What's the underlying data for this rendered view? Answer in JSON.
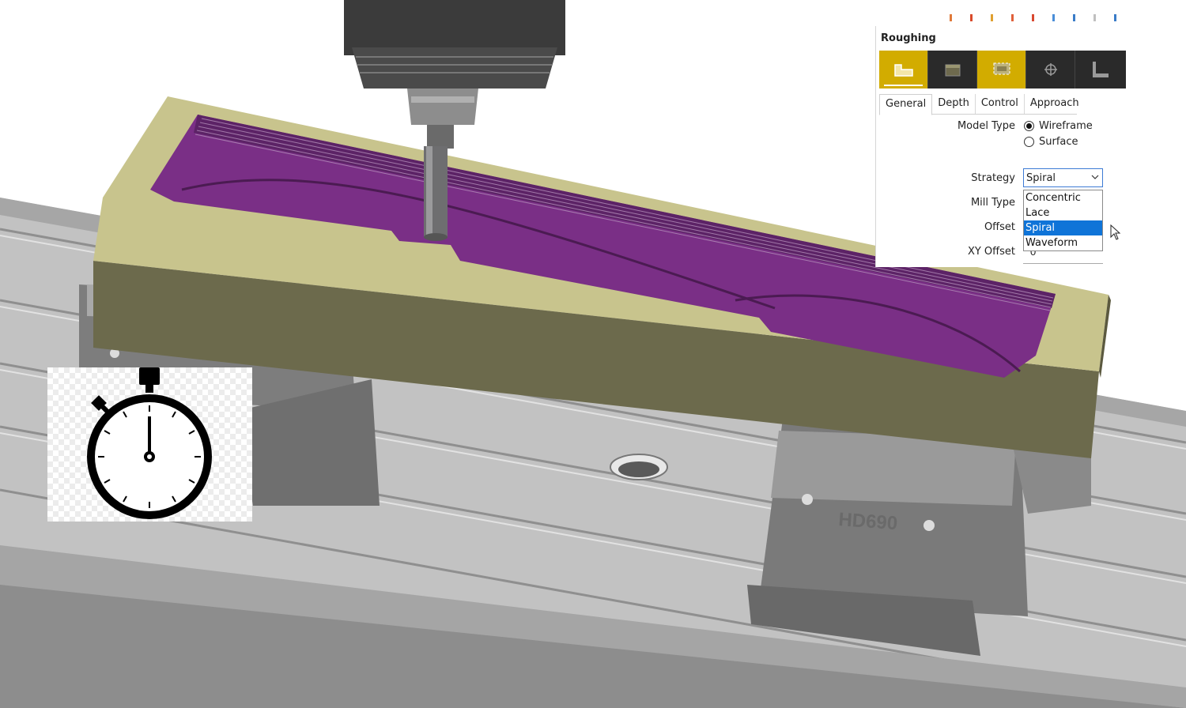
{
  "panel": {
    "title": "Roughing",
    "toolbar_buttons": [
      {
        "icon": "pocket-profile-icon",
        "active": true
      },
      {
        "icon": "stock-box-icon",
        "active": false
      },
      {
        "icon": "boundary-region-icon",
        "active": true
      },
      {
        "icon": "crosshair-origin-icon",
        "active": false
      },
      {
        "icon": "corner-profile-icon",
        "active": false
      }
    ],
    "tabs": [
      "General",
      "Depth",
      "Control",
      "Approach"
    ],
    "active_tab": "General",
    "model_type_label": "Model Type",
    "model_type_options": [
      "Wireframe",
      "Surface"
    ],
    "model_type_selected": "Wireframe",
    "strategy_label": "Strategy",
    "strategy_value": "Spiral",
    "strategy_options": [
      "Concentric",
      "Lace",
      "Spiral",
      "Waveform"
    ],
    "strategy_highlighted": "Spiral",
    "mill_type_label": "Mill Type",
    "offset_label": "Offset",
    "xy_offset_label": "XY Offset",
    "xy_offset_value": "0"
  },
  "scene": {
    "vise_label": "HD690",
    "colors": {
      "pocket": "#7a2f86",
      "stock_top": "#c8c48d",
      "stock_side": "#6c6a4c",
      "machine_table": "#bdbdbd",
      "active_tool": "#d2ac00",
      "selection": "#0f74d8"
    }
  },
  "overlay": {
    "icon": "stopwatch-icon"
  }
}
